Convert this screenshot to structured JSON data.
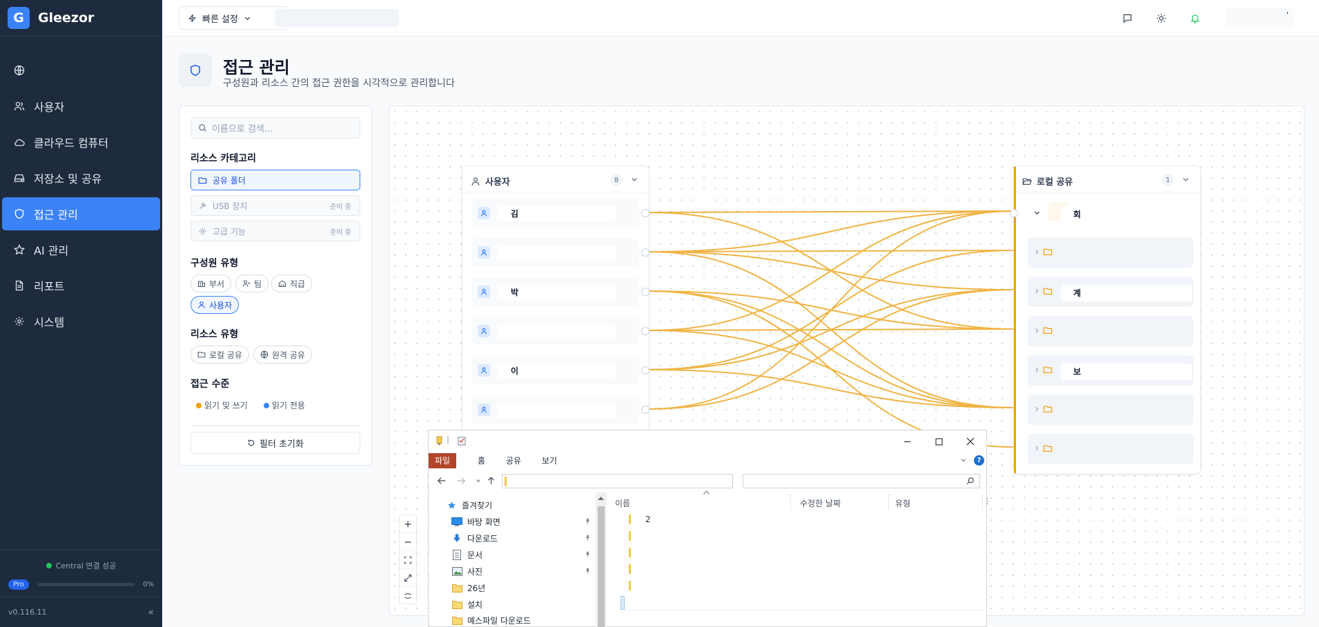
{
  "app": {
    "brand_letter": "G",
    "brand_name": "Gleezor"
  },
  "sidebar": {
    "items": [
      {
        "label": "",
        "icon": "globe-icon"
      },
      {
        "label": "사용자",
        "icon": "users-icon"
      },
      {
        "label": "클라우드 컴퓨터",
        "icon": "cloud-icon"
      },
      {
        "label": "저장소 및 공유",
        "icon": "drive-icon"
      },
      {
        "label": "접근 관리",
        "icon": "shield-icon",
        "active": true
      },
      {
        "label": "AI 관리",
        "icon": "star-icon"
      },
      {
        "label": "리포트",
        "icon": "report-icon"
      },
      {
        "label": "시스템",
        "icon": "gear-icon"
      }
    ],
    "status": "Central 연결 성공",
    "pro_badge": "Pro",
    "pro_progress": 0,
    "pro_percent_label": "0%",
    "version": "v0.116.11",
    "collapse_glyph": "«"
  },
  "header": {
    "quick_settings_label": "빠른 설정",
    "icons": [
      "message-icon",
      "sun-icon",
      "bell-icon"
    ],
    "user_suffix": "'"
  },
  "page": {
    "title": "접근 관리",
    "subtitle": "구성원과 리소스 간의 접근 권한을 시각적으로 관리합니다"
  },
  "filter": {
    "search_placeholder": "이름으로 검색...",
    "resource_category_heading": "리소스 카테고리",
    "categories": [
      {
        "label": "공유 폴더",
        "active": true,
        "badge": ""
      },
      {
        "label": "USB 장치",
        "active": false,
        "badge": "준비 중"
      },
      {
        "label": "고급 기능",
        "active": false,
        "badge": "준비 중"
      }
    ],
    "member_type_heading": "구성원 유형",
    "member_types": [
      {
        "label": "부서",
        "icon": "building-icon",
        "active": false
      },
      {
        "label": "팀",
        "icon": "team-icon",
        "active": false
      },
      {
        "label": "직급",
        "icon": "rank-icon",
        "active": false
      },
      {
        "label": "사용자",
        "icon": "user-icon",
        "active": true
      }
    ],
    "resource_type_heading": "리소스 유형",
    "resource_types": [
      {
        "label": "로컬 공유",
        "icon": "folder-icon"
      },
      {
        "label": "원격 공유",
        "icon": "globe-icon"
      }
    ],
    "access_level_heading": "접근 수준",
    "access_levels": [
      {
        "label": "읽기 및 쓰기",
        "color": "#f59e0b"
      },
      {
        "label": "읽기 전용",
        "color": "#3b82f6"
      }
    ],
    "reset_label": "필터 초기화"
  },
  "graph": {
    "user_node": {
      "title": "사용자",
      "count": "8"
    },
    "users": [
      {
        "name": "김"
      },
      {
        "name": ""
      },
      {
        "name": "박"
      },
      {
        "name": ""
      },
      {
        "name": "이"
      },
      {
        "name": ""
      }
    ],
    "resource_node": {
      "title": "로컬 공유",
      "count": "1"
    },
    "resources": [
      {
        "name": "회",
        "expanded": true
      },
      {
        "name": ""
      },
      {
        "name": "계"
      },
      {
        "name": ""
      },
      {
        "name": "보"
      },
      {
        "name": ""
      },
      {
        "name": ""
      }
    ],
    "edge_color": "#f0b444",
    "edges": [
      [
        0,
        0
      ],
      [
        0,
        3
      ],
      [
        1,
        0
      ],
      [
        1,
        1
      ],
      [
        1,
        2
      ],
      [
        1,
        5
      ],
      [
        2,
        3
      ],
      [
        2,
        5
      ],
      [
        2,
        6
      ],
      [
        3,
        0
      ],
      [
        3,
        3
      ],
      [
        3,
        5
      ],
      [
        4,
        1
      ],
      [
        4,
        2
      ],
      [
        4,
        5
      ],
      [
        5,
        0
      ],
      [
        5,
        2
      ]
    ]
  },
  "explorer": {
    "ribbon_tabs": [
      "파일",
      "홈",
      "공유",
      "보기"
    ],
    "tree": [
      {
        "label": "즐겨찾기",
        "icon": "star-icon",
        "pinned": false
      },
      {
        "label": "바탕 화면",
        "icon": "desktop-icon",
        "pinned": true
      },
      {
        "label": "다운로드",
        "icon": "download-icon",
        "pinned": true
      },
      {
        "label": "문서",
        "icon": "document-icon",
        "pinned": true
      },
      {
        "label": "사진",
        "icon": "picture-icon",
        "pinned": true
      },
      {
        "label": "26년",
        "icon": "folder-icon",
        "pinned": false
      },
      {
        "label": "설치",
        "icon": "folder-icon",
        "pinned": false
      },
      {
        "label": "예스파일 다운로드",
        "icon": "folder-icon",
        "pinned": false
      }
    ],
    "columns": [
      "이름",
      "수정한 날짜",
      "유형"
    ],
    "first_row_text": "2"
  }
}
